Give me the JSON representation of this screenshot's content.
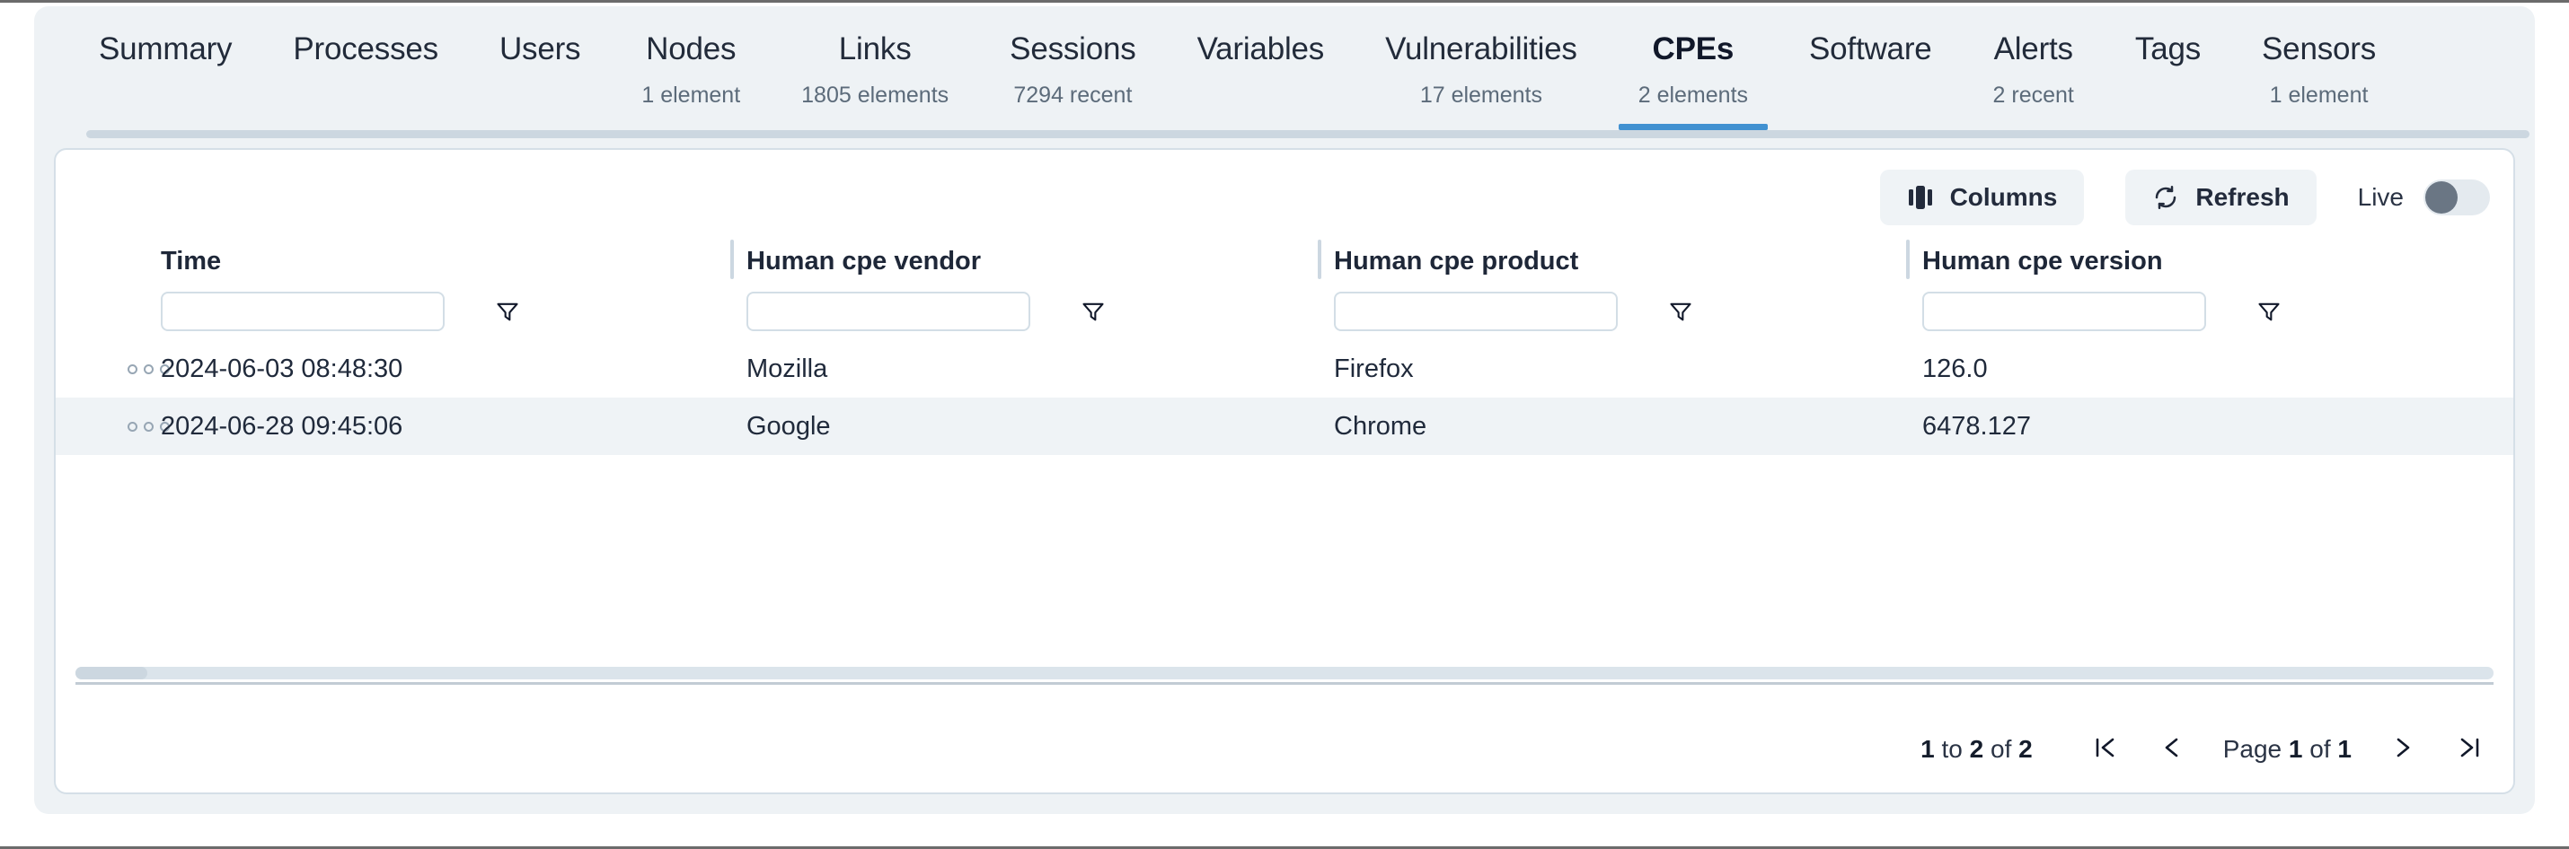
{
  "tabs": [
    {
      "label": "Summary",
      "count": "",
      "active": false
    },
    {
      "label": "Processes",
      "count": "",
      "active": false
    },
    {
      "label": "Users",
      "count": "",
      "active": false
    },
    {
      "label": "Nodes",
      "count": "1 element",
      "active": false
    },
    {
      "label": "Links",
      "count": "1805 elements",
      "active": false
    },
    {
      "label": "Sessions",
      "count": "7294 recent",
      "active": false
    },
    {
      "label": "Variables",
      "count": "",
      "active": false
    },
    {
      "label": "Vulnerabilities",
      "count": "17 elements",
      "active": false
    },
    {
      "label": "CPEs",
      "count": "2 elements",
      "active": true
    },
    {
      "label": "Software",
      "count": "",
      "active": false
    },
    {
      "label": "Alerts",
      "count": "2 recent",
      "active": false
    },
    {
      "label": "Tags",
      "count": "",
      "active": false
    },
    {
      "label": "Sensors",
      "count": "1 element",
      "active": false
    }
  ],
  "toolbar": {
    "columns_label": "Columns",
    "columns_icon": "columns-icon",
    "refresh_label": "Refresh",
    "refresh_icon": "refresh-icon",
    "live_label": "Live",
    "live_on": false
  },
  "table": {
    "columns": [
      {
        "title": "Time",
        "filter_value": "",
        "filter_placeholder": ""
      },
      {
        "title": "Human cpe vendor",
        "filter_value": "",
        "filter_placeholder": ""
      },
      {
        "title": "Human cpe product",
        "filter_value": "",
        "filter_placeholder": ""
      },
      {
        "title": "Human cpe version",
        "filter_value": "",
        "filter_placeholder": ""
      }
    ],
    "rows": [
      {
        "time": "2024-06-03 08:48:30",
        "vendor": "Mozilla",
        "product": "Firefox",
        "version": "126.0"
      },
      {
        "time": "2024-06-28 09:45:06",
        "vendor": "Google",
        "product": "Chrome",
        "version": "6478.127"
      }
    ],
    "row_menu_icon": "more-options-icon",
    "filter_icon": "funnel-icon"
  },
  "pagination": {
    "range_prefix": "1",
    "range_to": "to",
    "range_end": "2",
    "range_of": "of",
    "range_total": "2",
    "page_word": "Page",
    "page_current": "1",
    "page_of": "of",
    "page_total": "1",
    "first_icon": "first-page-icon",
    "prev_icon": "previous-page-icon",
    "next_icon": "next-page-icon",
    "last_icon": "last-page-icon"
  },
  "colors": {
    "accent": "#4191d1",
    "panel_bg": "#eef2f5",
    "card_bg": "#ffffff",
    "text": "#202a3b",
    "muted": "#5c6b7a",
    "border": "#d5dfe7"
  }
}
